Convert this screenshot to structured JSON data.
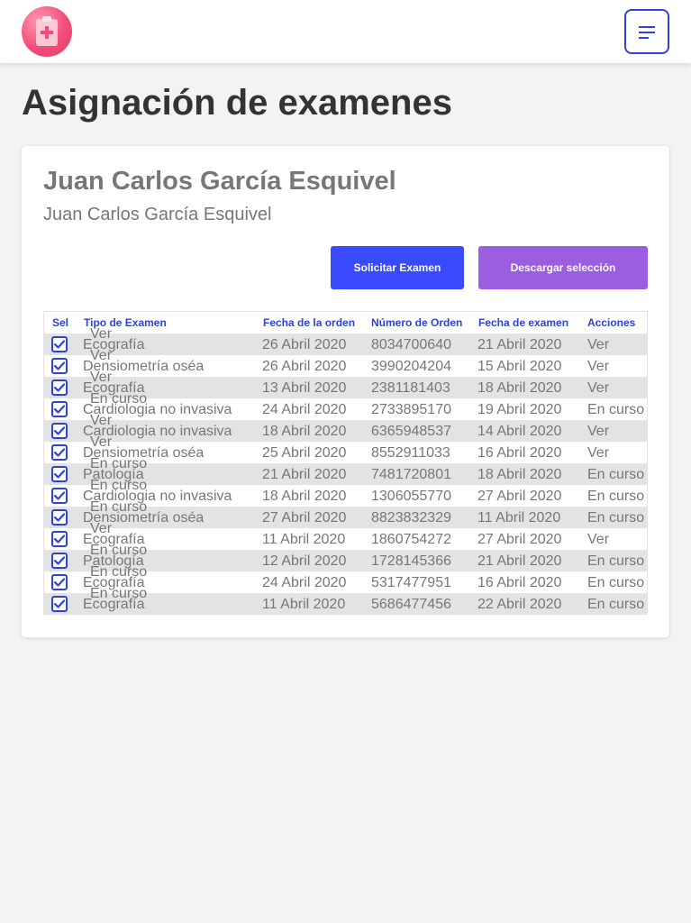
{
  "header": {
    "logo_icon": "clipboard-medical-icon",
    "menu_icon": "menu-icon"
  },
  "page": {
    "title": "Asignación de examenes"
  },
  "patient": {
    "name": "Juan Carlos García Esquivel",
    "subtitle": "Juan Carlos García Esquivel"
  },
  "actions": {
    "request_label": "Solicitar Examen",
    "download_label": "Descargar selección"
  },
  "colors": {
    "accent": "#2e43d8",
    "request_button": "#3a4aff",
    "download_button": "#9b5ee0",
    "logo": "#f24d7a"
  },
  "table": {
    "headers": [
      "Sel",
      "Tipo de Examen",
      "Fecha de la orden",
      "Número de Orden",
      "Fecha de examen",
      "Acciones"
    ],
    "rows": [
      {
        "selected": true,
        "type": "Ecografía",
        "order_date": "26 Abril 2020",
        "order_number": "8034700640",
        "exam_date": "21 Abril 2020",
        "action": "Ver"
      },
      {
        "selected": true,
        "type": "Densiometría oséa",
        "order_date": "26 Abril 2020",
        "order_number": "3990204204",
        "exam_date": "15 Abril 2020",
        "action": "Ver"
      },
      {
        "selected": true,
        "type": "Ecografía",
        "order_date": "13 Abril 2020",
        "order_number": "2381181403",
        "exam_date": "18 Abril 2020",
        "action": "Ver"
      },
      {
        "selected": true,
        "type": "Cardiologia no invasiva",
        "order_date": "24 Abril 2020",
        "order_number": "2733895170",
        "exam_date": "19 Abril 2020",
        "action": "En curso"
      },
      {
        "selected": true,
        "type": "Cardiologia no invasiva",
        "order_date": "18 Abril 2020",
        "order_number": "6365948537",
        "exam_date": "14 Abril 2020",
        "action": "Ver"
      },
      {
        "selected": true,
        "type": "Densiometría oséa",
        "order_date": "25 Abril 2020",
        "order_number": "8552911033",
        "exam_date": "16 Abril 2020",
        "action": "Ver"
      },
      {
        "selected": true,
        "type": "Patología",
        "order_date": "21 Abril 2020",
        "order_number": "7481720801",
        "exam_date": "18 Abril 2020",
        "action": "En curso"
      },
      {
        "selected": true,
        "type": "Cardiologia no invasiva",
        "order_date": "18 Abril 2020",
        "order_number": "1306055770",
        "exam_date": "27 Abril 2020",
        "action": "En curso"
      },
      {
        "selected": true,
        "type": "Densiometría oséa",
        "order_date": "27 Abril 2020",
        "order_number": "8823832329",
        "exam_date": "11 Abril 2020",
        "action": "En curso"
      },
      {
        "selected": true,
        "type": "Ecografía",
        "order_date": "11 Abril 2020",
        "order_number": "1860754272",
        "exam_date": "27 Abril 2020",
        "action": "Ver"
      },
      {
        "selected": true,
        "type": "Patología",
        "order_date": "12 Abril 2020",
        "order_number": "1728145366",
        "exam_date": "21 Abril 2020",
        "action": "En curso"
      },
      {
        "selected": true,
        "type": "Ecografía",
        "order_date": "24 Abril 2020",
        "order_number": "5317477951",
        "exam_date": "16 Abril 2020",
        "action": "En curso"
      },
      {
        "selected": true,
        "type": "Ecografía",
        "order_date": "11 Abril 2020",
        "order_number": "5686477456",
        "exam_date": "22 Abril 2020",
        "action": "En curso"
      }
    ]
  }
}
